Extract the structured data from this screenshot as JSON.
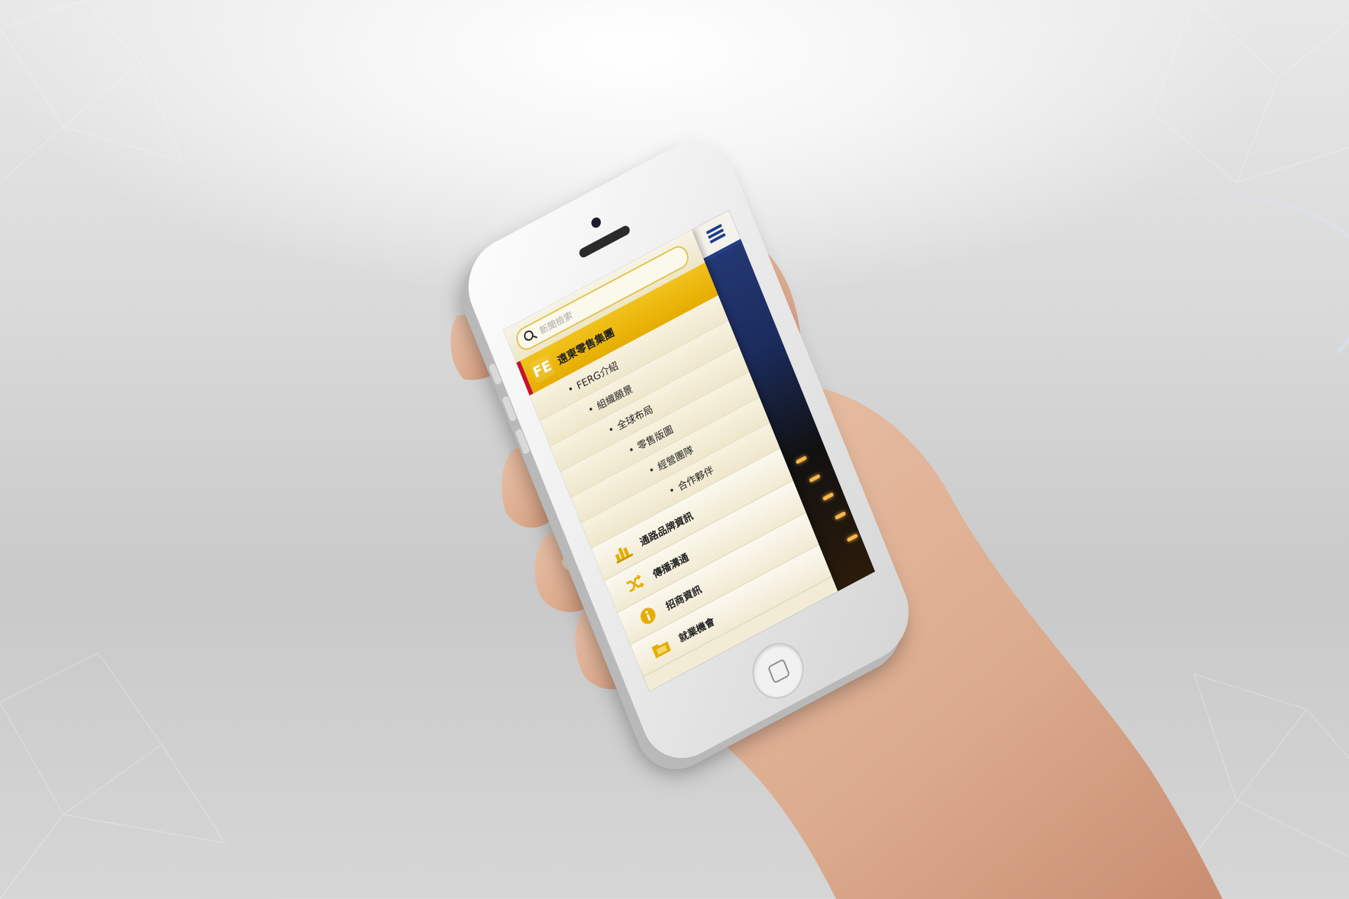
{
  "search": {
    "placeholder": "新聞檢索"
  },
  "drawer": {
    "group": {
      "logo_text": "FE",
      "label": "遠東零售集團"
    },
    "sub_items": [
      {
        "label": "FERG介紹"
      },
      {
        "label": "組織願景"
      },
      {
        "label": "全球布局"
      },
      {
        "label": "零售版圖"
      },
      {
        "label": "經營團隊"
      },
      {
        "label": "合作夥伴"
      }
    ],
    "main_items": [
      {
        "label": "通路品牌資訊",
        "icon": "bar-chart-icon"
      },
      {
        "label": "傳播溝通",
        "icon": "shuffle-icon"
      },
      {
        "label": "招商資訊",
        "icon": "info-icon"
      },
      {
        "label": "就業機會",
        "icon": "folder-icon"
      }
    ]
  },
  "colors": {
    "accent_yellow": "#e6ad00",
    "accent_red": "#c8102e",
    "brand_blue": "#1c3d8f"
  }
}
